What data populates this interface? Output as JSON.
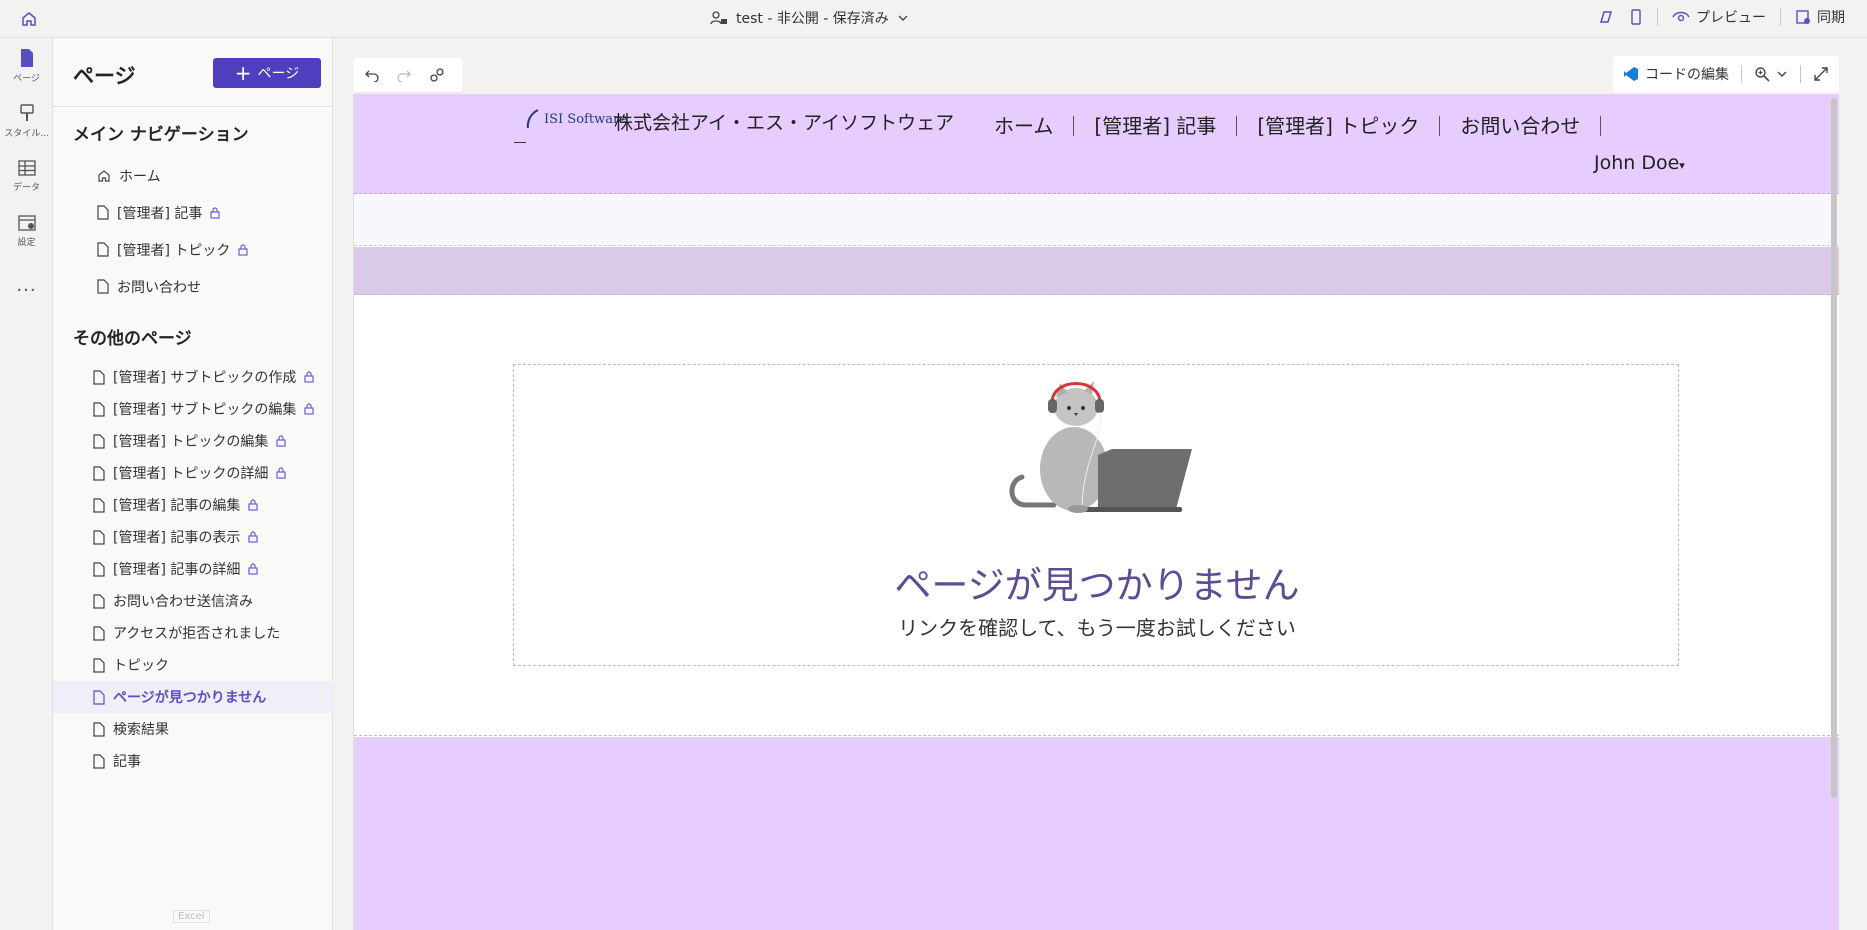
{
  "topbar": {
    "site_status": "test - 非公開 - 保存済み",
    "preview_label": "プレビュー",
    "sync_label": "同期"
  },
  "rail": {
    "items": [
      {
        "label": "ページ",
        "icon": "page-icon",
        "active": true
      },
      {
        "label": "スタイル...",
        "icon": "brush-icon"
      },
      {
        "label": "データ",
        "icon": "table-icon"
      },
      {
        "label": "設定",
        "icon": "settings-icon"
      },
      {
        "label": "...",
        "icon": "more-icon"
      }
    ]
  },
  "panel": {
    "title": "ページ",
    "add_button": "ページ",
    "main_nav_title": "メイン ナビゲーション",
    "main_nav": [
      {
        "label": "ホーム",
        "icon": "home-icon",
        "locked": false
      },
      {
        "label": "[管理者] 記事",
        "icon": "page-icon",
        "locked": true
      },
      {
        "label": "[管理者] トピック",
        "icon": "page-icon",
        "locked": true
      },
      {
        "label": "お問い合わせ",
        "icon": "page-icon",
        "locked": false
      }
    ],
    "other_title": "その他のページ",
    "other_pages": [
      {
        "label": "[管理者] サブトピックの作成",
        "locked": true
      },
      {
        "label": "[管理者] サブトピックの編集",
        "locked": true
      },
      {
        "label": "[管理者] トピックの編集",
        "locked": true
      },
      {
        "label": "[管理者] トピックの詳細",
        "locked": true
      },
      {
        "label": "[管理者] 記事の編集",
        "locked": true
      },
      {
        "label": "[管理者] 記事の表示",
        "locked": true
      },
      {
        "label": "[管理者] 記事の詳細",
        "locked": true
      },
      {
        "label": "お問い合わせ送信済み",
        "locked": false
      },
      {
        "label": "アクセスが拒否されました",
        "locked": false
      },
      {
        "label": "トピック",
        "locked": false
      },
      {
        "label": "ページが見つかりません",
        "locked": false,
        "active": true
      },
      {
        "label": "検索結果",
        "locked": false
      },
      {
        "label": "記事",
        "locked": false
      }
    ],
    "footer_tag": "Excel"
  },
  "canvas_toolbar": {
    "edit_code_label": "コードの編集"
  },
  "site": {
    "logo_text": "ISI Software",
    "company": "株式会社アイ・エス・アイソフトウェア",
    "nav": [
      "ホーム",
      "[管理者] 記事",
      "[管理者] トピック",
      "お問い合わせ"
    ],
    "user": "John Doe",
    "not_found_title": "ページが見つかりません",
    "not_found_sub": "リンクを確認して、もう一度お試しください"
  },
  "colors": {
    "accent": "#4f3fbf",
    "header_bg": "#e6ccff",
    "band_bg": "#d8cae8",
    "title_color": "#5e4c92"
  }
}
